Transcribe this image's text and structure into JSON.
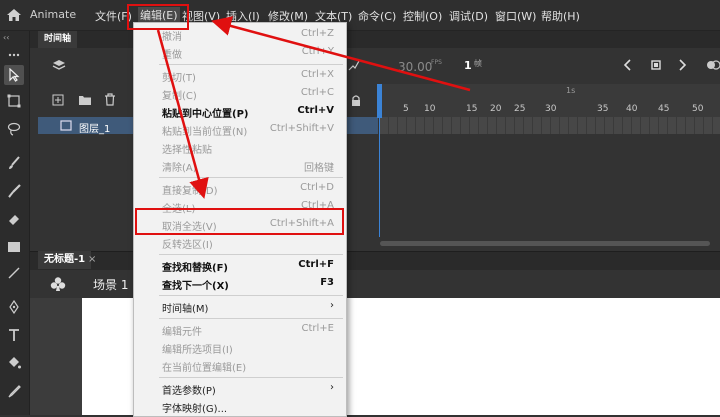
{
  "app": {
    "name": "Animate"
  },
  "menubar": {
    "items": [
      "文件(F)",
      "编辑(E)",
      "视图(V)",
      "插入(I)",
      "修改(M)",
      "文本(T)",
      "命令(C)",
      "控制(O)",
      "调试(D)",
      "窗口(W)",
      "帮助(H)"
    ]
  },
  "edit_menu": {
    "items": [
      {
        "label": "撤消",
        "shortcut": "Ctrl+Z",
        "state": "disabled"
      },
      {
        "label": "重做",
        "shortcut": "Ctrl+Y",
        "state": "disabled"
      },
      {
        "label": "剪切(T)",
        "shortcut": "Ctrl+X",
        "state": "disabled"
      },
      {
        "label": "复制(C)",
        "shortcut": "Ctrl+C",
        "state": "disabled"
      },
      {
        "label": "粘贴到中心位置(P)",
        "shortcut": "Ctrl+V",
        "state": "bold"
      },
      {
        "label": "粘贴到当前位置(N)",
        "shortcut": "Ctrl+Shift+V",
        "state": "disabled"
      },
      {
        "label": "选择性粘贴",
        "shortcut": "",
        "state": "disabled"
      },
      {
        "label": "清除(A)",
        "shortcut": "回格键",
        "state": "disabled"
      },
      {
        "label": "直接复制(D)",
        "shortcut": "Ctrl+D",
        "state": "disabled"
      },
      {
        "label": "全选(L)",
        "shortcut": "Ctrl+A",
        "state": "disabled"
      },
      {
        "label": "取消全选(V)",
        "shortcut": "Ctrl+Shift+A",
        "state": "disabled"
      },
      {
        "label": "反转选区(I)",
        "shortcut": "",
        "state": "disabled"
      },
      {
        "label": "查找和替换(F)",
        "shortcut": "Ctrl+F",
        "state": "bold"
      },
      {
        "label": "查找下一个(X)",
        "shortcut": "F3",
        "state": "bold"
      },
      {
        "label": "时间轴(M)",
        "shortcut": "›",
        "state": "normal"
      },
      {
        "label": "编辑元件",
        "shortcut": "Ctrl+E",
        "state": "disabled"
      },
      {
        "label": "编辑所选项目(I)",
        "shortcut": "",
        "state": "disabled"
      },
      {
        "label": "在当前位置编辑(E)",
        "shortcut": "",
        "state": "disabled"
      },
      {
        "label": "首选参数(P)",
        "shortcut": "›",
        "state": "normal"
      },
      {
        "label": "字体映射(G)...",
        "shortcut": "",
        "state": "normal"
      }
    ]
  },
  "timeline": {
    "tab": "时间轴",
    "fps": "30.00",
    "fps_unit": "FPS",
    "frame": "1",
    "frame_unit": "帧",
    "ruler_ticks": [
      "5",
      "10",
      "15",
      "20",
      "25",
      "30",
      "35",
      "40",
      "45",
      "50"
    ],
    "ruler_second": "1s",
    "layer_name": "图层_1"
  },
  "document": {
    "tab": "无标题-1",
    "close": "×",
    "scene": "场景 1"
  },
  "colors": {
    "annotation": "#e01010",
    "playhead": "#3b83d6",
    "layer_selected": "#3f5a7a"
  }
}
